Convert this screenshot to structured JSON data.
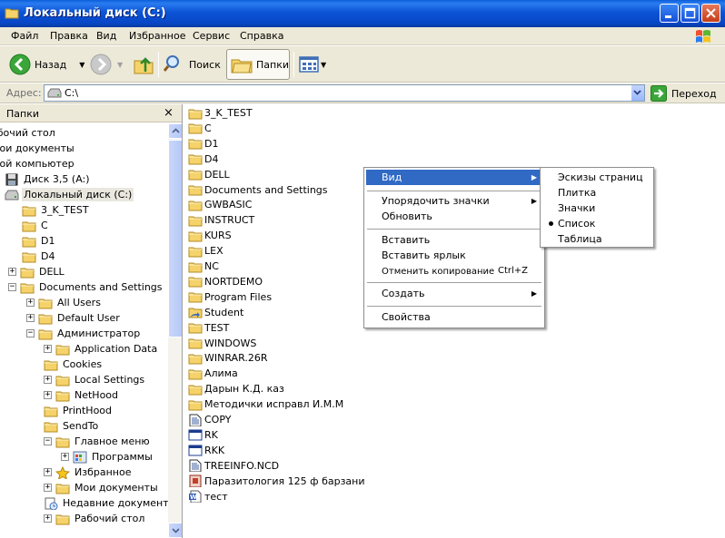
{
  "window": {
    "title": "Локальный диск (C:)"
  },
  "menu": [
    "Файл",
    "Правка",
    "Вид",
    "Избранное",
    "Сервис",
    "Справка"
  ],
  "toolbar": {
    "back": "Назад",
    "search": "Поиск",
    "folders": "Папки"
  },
  "address": {
    "label": "Адрес:",
    "value": "C:\\",
    "go": "Переход"
  },
  "folders_pane": {
    "title": "Папки",
    "close": "×",
    "tree": [
      {
        "label": "абочий стол",
        "icon": "desktop-icon"
      },
      {
        "label": "Мои документы",
        "icon": "my-documents-icon"
      },
      {
        "label": "Мой компьютер",
        "icon": "my-computer-icon"
      },
      {
        "label": "Диск 3,5 (A:)",
        "icon": "floppy-icon"
      },
      {
        "label": "Локальный диск (C:)",
        "icon": "hard-drive-icon"
      },
      {
        "label": "3_K_TEST",
        "icon": "folder-icon"
      },
      {
        "label": "C",
        "icon": "folder-icon"
      },
      {
        "label": "D1",
        "icon": "folder-icon"
      },
      {
        "label": "D4",
        "icon": "folder-icon"
      },
      {
        "label": "DELL",
        "icon": "folder-icon",
        "exp": "+"
      },
      {
        "label": "Documents and Settings",
        "icon": "folder-icon",
        "exp": "−"
      },
      {
        "label": "All Users",
        "icon": "folder-icon",
        "exp": "+"
      },
      {
        "label": "Default User",
        "icon": "folder-icon",
        "exp": "+"
      },
      {
        "label": "Администратор",
        "icon": "folder-icon",
        "exp": "−"
      },
      {
        "label": "Application Data",
        "icon": "folder-icon",
        "exp": "+"
      },
      {
        "label": "Cookies",
        "icon": "folder-icon"
      },
      {
        "label": "Local Settings",
        "icon": "folder-icon",
        "exp": "+"
      },
      {
        "label": "NetHood",
        "icon": "folder-icon",
        "exp": "+"
      },
      {
        "label": "PrintHood",
        "icon": "folder-icon"
      },
      {
        "label": "SendTo",
        "icon": "folder-icon"
      },
      {
        "label": "Главное меню",
        "icon": "folder-icon",
        "exp": "−"
      },
      {
        "label": "Программы",
        "icon": "programs-icon",
        "exp": "+"
      },
      {
        "label": "Избранное",
        "icon": "favorites-star-icon",
        "exp": "+"
      },
      {
        "label": "Мои документы",
        "icon": "folder-icon",
        "exp": "+"
      },
      {
        "label": "Недавние документ",
        "icon": "recent-docs-icon"
      },
      {
        "label": "Рабочий стол",
        "icon": "folder-icon",
        "exp": "+"
      }
    ]
  },
  "files": [
    {
      "name": "3_K_TEST",
      "icon": "folder-icon"
    },
    {
      "name": "C",
      "icon": "folder-icon"
    },
    {
      "name": "D1",
      "icon": "folder-icon"
    },
    {
      "name": "D4",
      "icon": "folder-icon"
    },
    {
      "name": "DELL",
      "icon": "folder-icon"
    },
    {
      "name": "Documents and Settings",
      "icon": "folder-icon"
    },
    {
      "name": "GWBASIC",
      "icon": "folder-icon"
    },
    {
      "name": "INSTRUCT",
      "icon": "folder-icon"
    },
    {
      "name": "KURS",
      "icon": "folder-icon"
    },
    {
      "name": "LEX",
      "icon": "folder-icon"
    },
    {
      "name": "NC",
      "icon": "folder-icon"
    },
    {
      "name": "NORTDEMO",
      "icon": "folder-icon"
    },
    {
      "name": "Program Files",
      "icon": "folder-icon"
    },
    {
      "name": "Student",
      "icon": "shared-folder-icon"
    },
    {
      "name": "TEST",
      "icon": "folder-icon"
    },
    {
      "name": "WINDOWS",
      "icon": "folder-icon"
    },
    {
      "name": "WINRAR.26R",
      "icon": "folder-icon"
    },
    {
      "name": "Алима",
      "icon": "folder-icon"
    },
    {
      "name": "Дарын К.Д. каз",
      "icon": "folder-icon"
    },
    {
      "name": "Методички исправл И.М.М",
      "icon": "folder-icon"
    },
    {
      "name": "COPY",
      "icon": "text-file-icon"
    },
    {
      "name": "RK",
      "icon": "exe-file-icon"
    },
    {
      "name": "RKK",
      "icon": "exe-file-icon"
    },
    {
      "name": "TREEINFO.NCD",
      "icon": "text-file-icon"
    },
    {
      "name": "Паразитология 125 ф барзани",
      "icon": "archive-file-icon"
    },
    {
      "name": "тест",
      "icon": "word-doc-icon"
    }
  ],
  "context_menu": {
    "view": "Вид",
    "arrange": "Упорядочить значки",
    "refresh": "Обновить",
    "paste": "Вставить",
    "paste_shortcut": "Вставить ярлык",
    "undo_copy": "Отменить копирование",
    "undo_accel": "Ctrl+Z",
    "create": "Создать",
    "properties": "Свойства"
  },
  "view_submenu": {
    "items": [
      "Эскизы страниц",
      "Плитка",
      "Значки",
      "Список",
      "Таблица"
    ],
    "selected": "Список"
  },
  "colors": {
    "title_bar": "#0b54d6",
    "highlight": "#316ac5",
    "chrome": "#ece9d8",
    "folder": "#f5d36a"
  }
}
